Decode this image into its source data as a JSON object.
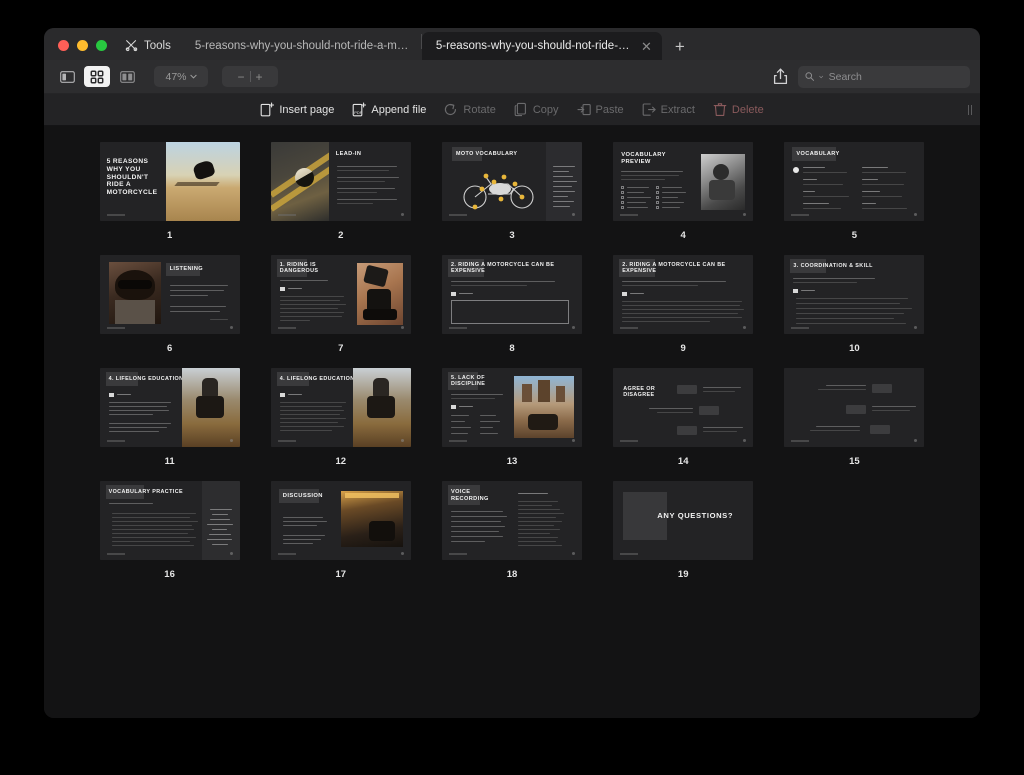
{
  "window": {
    "tools_label": "Tools",
    "tabs": [
      {
        "label": "5-reasons-why-you-should-not-ride-a-mot...",
        "active": false
      },
      {
        "label": "5-reasons-why-you-should-not-ride-a-mo...",
        "active": true
      }
    ],
    "new_tab_label": "+"
  },
  "toolbar": {
    "view_modes": [
      "sidebar-view",
      "grid-view",
      "split-view"
    ],
    "active_view": "grid-view",
    "zoom_level": "47%",
    "zoom_out_label": "−",
    "zoom_in_label": "+",
    "share_icon": "share-icon",
    "search_placeholder": "Search"
  },
  "actions": [
    {
      "label": "Insert page",
      "icon": "insert-page-icon",
      "state": "enabled"
    },
    {
      "label": "Append file",
      "icon": "append-file-icon",
      "state": "enabled"
    },
    {
      "label": "Rotate",
      "icon": "rotate-icon",
      "state": "disabled"
    },
    {
      "label": "Copy",
      "icon": "copy-icon",
      "state": "disabled"
    },
    {
      "label": "Paste",
      "icon": "paste-icon",
      "state": "disabled"
    },
    {
      "label": "Extract",
      "icon": "extract-icon",
      "state": "disabled"
    },
    {
      "label": "Delete",
      "icon": "delete-icon",
      "state": "danger-disabled"
    }
  ],
  "pages": [
    {
      "number": "1",
      "title": "5 REASONS WHY YOU SHOULDN'T RIDE A MOTORCYCLE",
      "layout": "title-right-photo"
    },
    {
      "number": "2",
      "title": "LEAD-IN",
      "layout": "photo-left-bullets"
    },
    {
      "number": "3",
      "title": "MOTO VOCABULARY",
      "layout": "diagram-word-list"
    },
    {
      "number": "4",
      "title": "VOCABULARY PREVIEW",
      "layout": "checklist-right-photo"
    },
    {
      "number": "5",
      "title": "VOCABULARY",
      "layout": "two-column-glossary"
    },
    {
      "number": "6",
      "title": "LISTENING",
      "layout": "photo-left-text-right"
    },
    {
      "number": "7",
      "title": "1. RIDING IS DANGEROUS",
      "layout": "text-left-photo-right"
    },
    {
      "number": "8",
      "title": "2. RIDING A MOTORCYCLE CAN BE EXPENSIVE",
      "layout": "empty-answer-box"
    },
    {
      "number": "9",
      "title": "2. RIDING A MOTORCYCLE CAN BE EXPENSIVE",
      "layout": "filled-transcript"
    },
    {
      "number": "10",
      "title": "3. COORDINATION & SKILL",
      "layout": "numbered-statements"
    },
    {
      "number": "11",
      "title": "4. LIFELONG EDUCATION",
      "layout": "text-left-photo-right"
    },
    {
      "number": "12",
      "title": "4. LIFELONG EDUCATION",
      "layout": "text-left-photo-right"
    },
    {
      "number": "13",
      "title": "5. LACK OF DISCIPLINE",
      "layout": "wordbank-photo-right"
    },
    {
      "number": "14",
      "title": "AGREE OR DISAGREE",
      "layout": "statement-cards"
    },
    {
      "number": "15",
      "title": "",
      "layout": "statement-cards-untitled"
    },
    {
      "number": "16",
      "title": "VOCABULARY PRACTICE",
      "layout": "numbered-gapfill-wordbank"
    },
    {
      "number": "17",
      "title": "DISCUSSION",
      "layout": "text-left-photo-right"
    },
    {
      "number": "18",
      "title": "VOICE RECORDING",
      "layout": "text-left-list-right"
    },
    {
      "number": "19",
      "title": "ANY QUESTIONS?",
      "layout": "closing"
    }
  ],
  "page_subtitles": {
    "1": "",
    "7": "Listen and fill in the blanks.",
    "8": "From the title, guess what the speaker will talk about next. Suggest several possible reasons why motorcycling can be expensive.",
    "9": "From the title, guess what the speaker will talk about next. Suggest several possible reasons why motorcycling can be expensive.",
    "10": "Listen to the next part and identify which statements are true or false. Then, explain your reasoning.",
    "13": "Listen and then summarize the first paragraph using the suggested key words.",
    "16": "Replace the words in sentences.",
    "18": "Suggested answers"
  },
  "audio_labels": {
    "7": "Audio 1",
    "8": "Audio 2",
    "9": "Audio 2",
    "10": "Audio 3",
    "11": "Audio 4",
    "12": "Audio 4",
    "13": "Audio 5"
  },
  "colors": {
    "window_bg": "#1c1c1e",
    "canvas_bg": "#131314",
    "toolbar_bg": "#2d2d2f",
    "action_bar_bg": "#232325",
    "slide_bg": "#232325",
    "accent_white": "#f2f2f2",
    "delete_red": "#8a5a5c",
    "traffic_red": "#ff5f57",
    "traffic_yellow": "#febc2e",
    "traffic_green": "#28c840"
  }
}
